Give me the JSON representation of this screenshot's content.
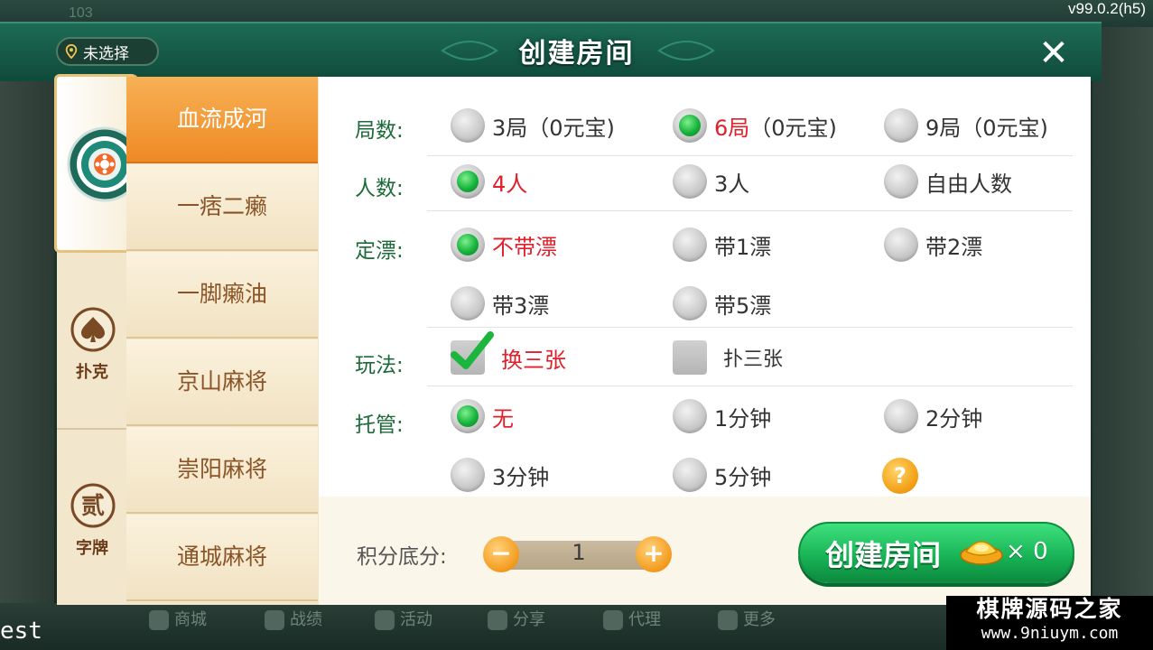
{
  "version": "v99.0.2(h5)",
  "background": {
    "top_text": "103",
    "left_bottom_text": "est",
    "bottom_nav": [
      "商城",
      "战绩",
      "活动",
      "分享",
      "代理",
      "更多"
    ]
  },
  "dialog": {
    "title": "创建房间",
    "location": {
      "label": "未选择",
      "icon": "location-pin-icon"
    },
    "close_icon": "close-icon"
  },
  "categories": [
    {
      "label": "",
      "icon": "mahjong-emblem-icon",
      "active": true
    },
    {
      "label": "扑克",
      "icon": "spade-icon",
      "active": false
    },
    {
      "label": "字牌",
      "icon": "er-badge-icon",
      "badge_char": "贰",
      "active": false
    }
  ],
  "games": [
    {
      "label": "血流成河",
      "active": true
    },
    {
      "label": "一痞二癞",
      "active": false
    },
    {
      "label": "一脚癞油",
      "active": false
    },
    {
      "label": "京山麻将",
      "active": false
    },
    {
      "label": "崇阳麻将",
      "active": false
    },
    {
      "label": "通城麻将",
      "active": false
    }
  ],
  "options": {
    "rounds": {
      "label": "局数:",
      "choices": [
        {
          "label": "3局（0元宝)",
          "selected": false
        },
        {
          "label": "6局",
          "suffix": "（0元宝)",
          "selected": true
        },
        {
          "label": "9局（0元宝)",
          "selected": false
        }
      ]
    },
    "players": {
      "label": "人数:",
      "choices": [
        {
          "label": "4人",
          "selected": true
        },
        {
          "label": "3人",
          "selected": false
        },
        {
          "label": "自由人数",
          "selected": false
        }
      ]
    },
    "piao": {
      "label": "定漂:",
      "choices": [
        {
          "label": "不带漂",
          "selected": true
        },
        {
          "label": "带1漂",
          "selected": false
        },
        {
          "label": "带2漂",
          "selected": false
        },
        {
          "label": "带3漂",
          "selected": false
        },
        {
          "label": "带5漂",
          "selected": false
        }
      ]
    },
    "play": {
      "label": "玩法:",
      "choices": [
        {
          "label": "换三张",
          "checked": true
        },
        {
          "label": "扑三张",
          "checked": false
        }
      ]
    },
    "auto": {
      "label": "托管:",
      "choices": [
        {
          "label": "无",
          "selected": true
        },
        {
          "label": "1分钟",
          "selected": false
        },
        {
          "label": "2分钟",
          "selected": false
        },
        {
          "label": "3分钟",
          "selected": false
        },
        {
          "label": "5分钟",
          "selected": false
        }
      ],
      "help": "?"
    }
  },
  "score": {
    "label": "积分底分:",
    "value": "1",
    "minus": "−",
    "plus": "+"
  },
  "create": {
    "label": "创建房间",
    "cost_prefix": "×",
    "cost": "0",
    "icon": "gold-ingot-icon"
  },
  "watermark": {
    "line1": "棋牌源码之家",
    "line2": "www.9niuym.com"
  },
  "colors": {
    "accent_green": "#16b154",
    "selected_red": "#e0202a",
    "tab_orange": "#ef8a25",
    "label_green": "#1d6b3a"
  }
}
